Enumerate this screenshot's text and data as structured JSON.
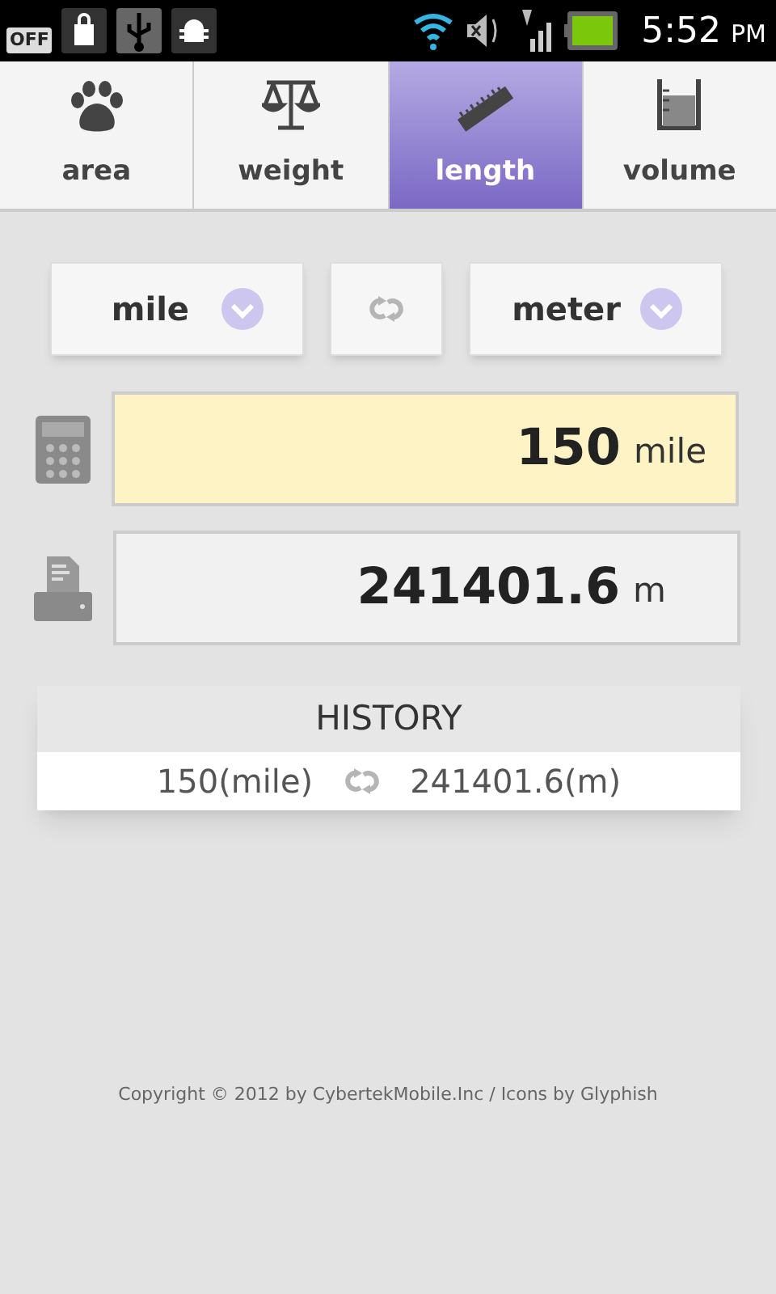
{
  "status_bar": {
    "off_label": "OFF",
    "time": "5:52",
    "ampm": "PM"
  },
  "tabs": [
    {
      "label": "area",
      "kind": "paw",
      "selected": false
    },
    {
      "label": "weight",
      "kind": "scale",
      "selected": false
    },
    {
      "label": "length",
      "kind": "ruler",
      "selected": true
    },
    {
      "label": "volume",
      "kind": "beaker",
      "selected": false
    }
  ],
  "units": {
    "from": "mile",
    "to": "meter"
  },
  "input": {
    "value": "150",
    "unit": "mile"
  },
  "output": {
    "value": "241401.6",
    "unit": "m"
  },
  "history": {
    "title": "HISTORY",
    "rows": [
      {
        "from": "150(mile)",
        "to": "241401.6(m)"
      }
    ]
  },
  "footer": "Copyright © 2012 by CybertekMobile.Inc / Icons by Glyphish"
}
